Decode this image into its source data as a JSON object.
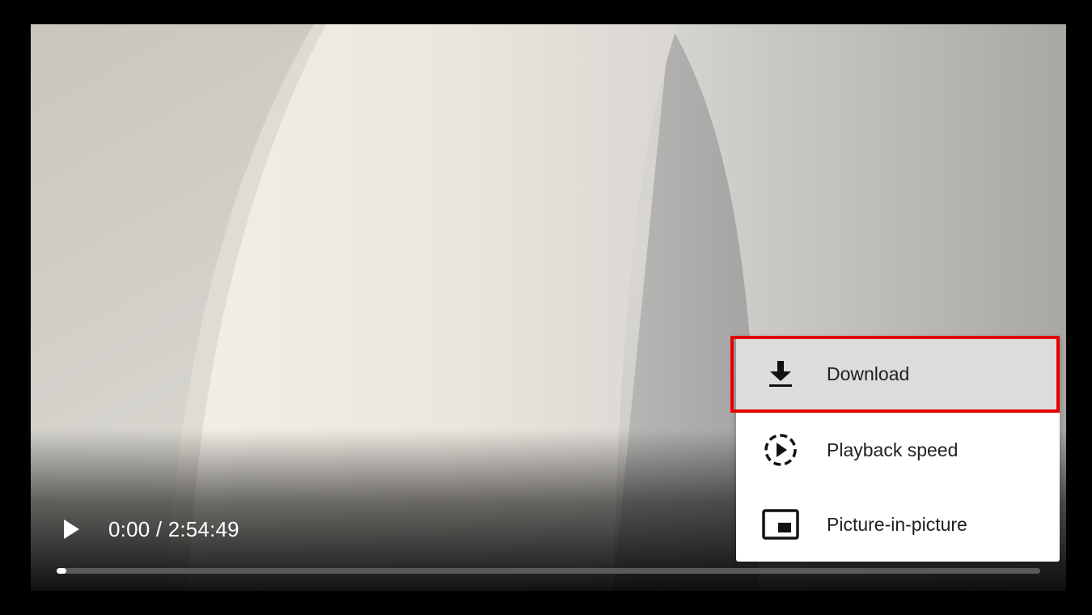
{
  "player": {
    "current_time": "0:00",
    "separator": " / ",
    "duration": "2:54:49",
    "progress_fraction": 0.01
  },
  "menu": {
    "items": [
      {
        "label": "Download",
        "icon": "download-icon",
        "highlighted": true
      },
      {
        "label": "Playback speed",
        "icon": "playback-speed-icon",
        "highlighted": false
      },
      {
        "label": "Picture-in-picture",
        "icon": "picture-in-picture-icon",
        "highlighted": false
      }
    ]
  },
  "colors": {
    "highlight_border": "#e60000",
    "menu_hover": "#dcdcdc",
    "menu_background": "#ffffff",
    "progress_played": "#ffffff",
    "progress_track": "#5a5a5a"
  }
}
